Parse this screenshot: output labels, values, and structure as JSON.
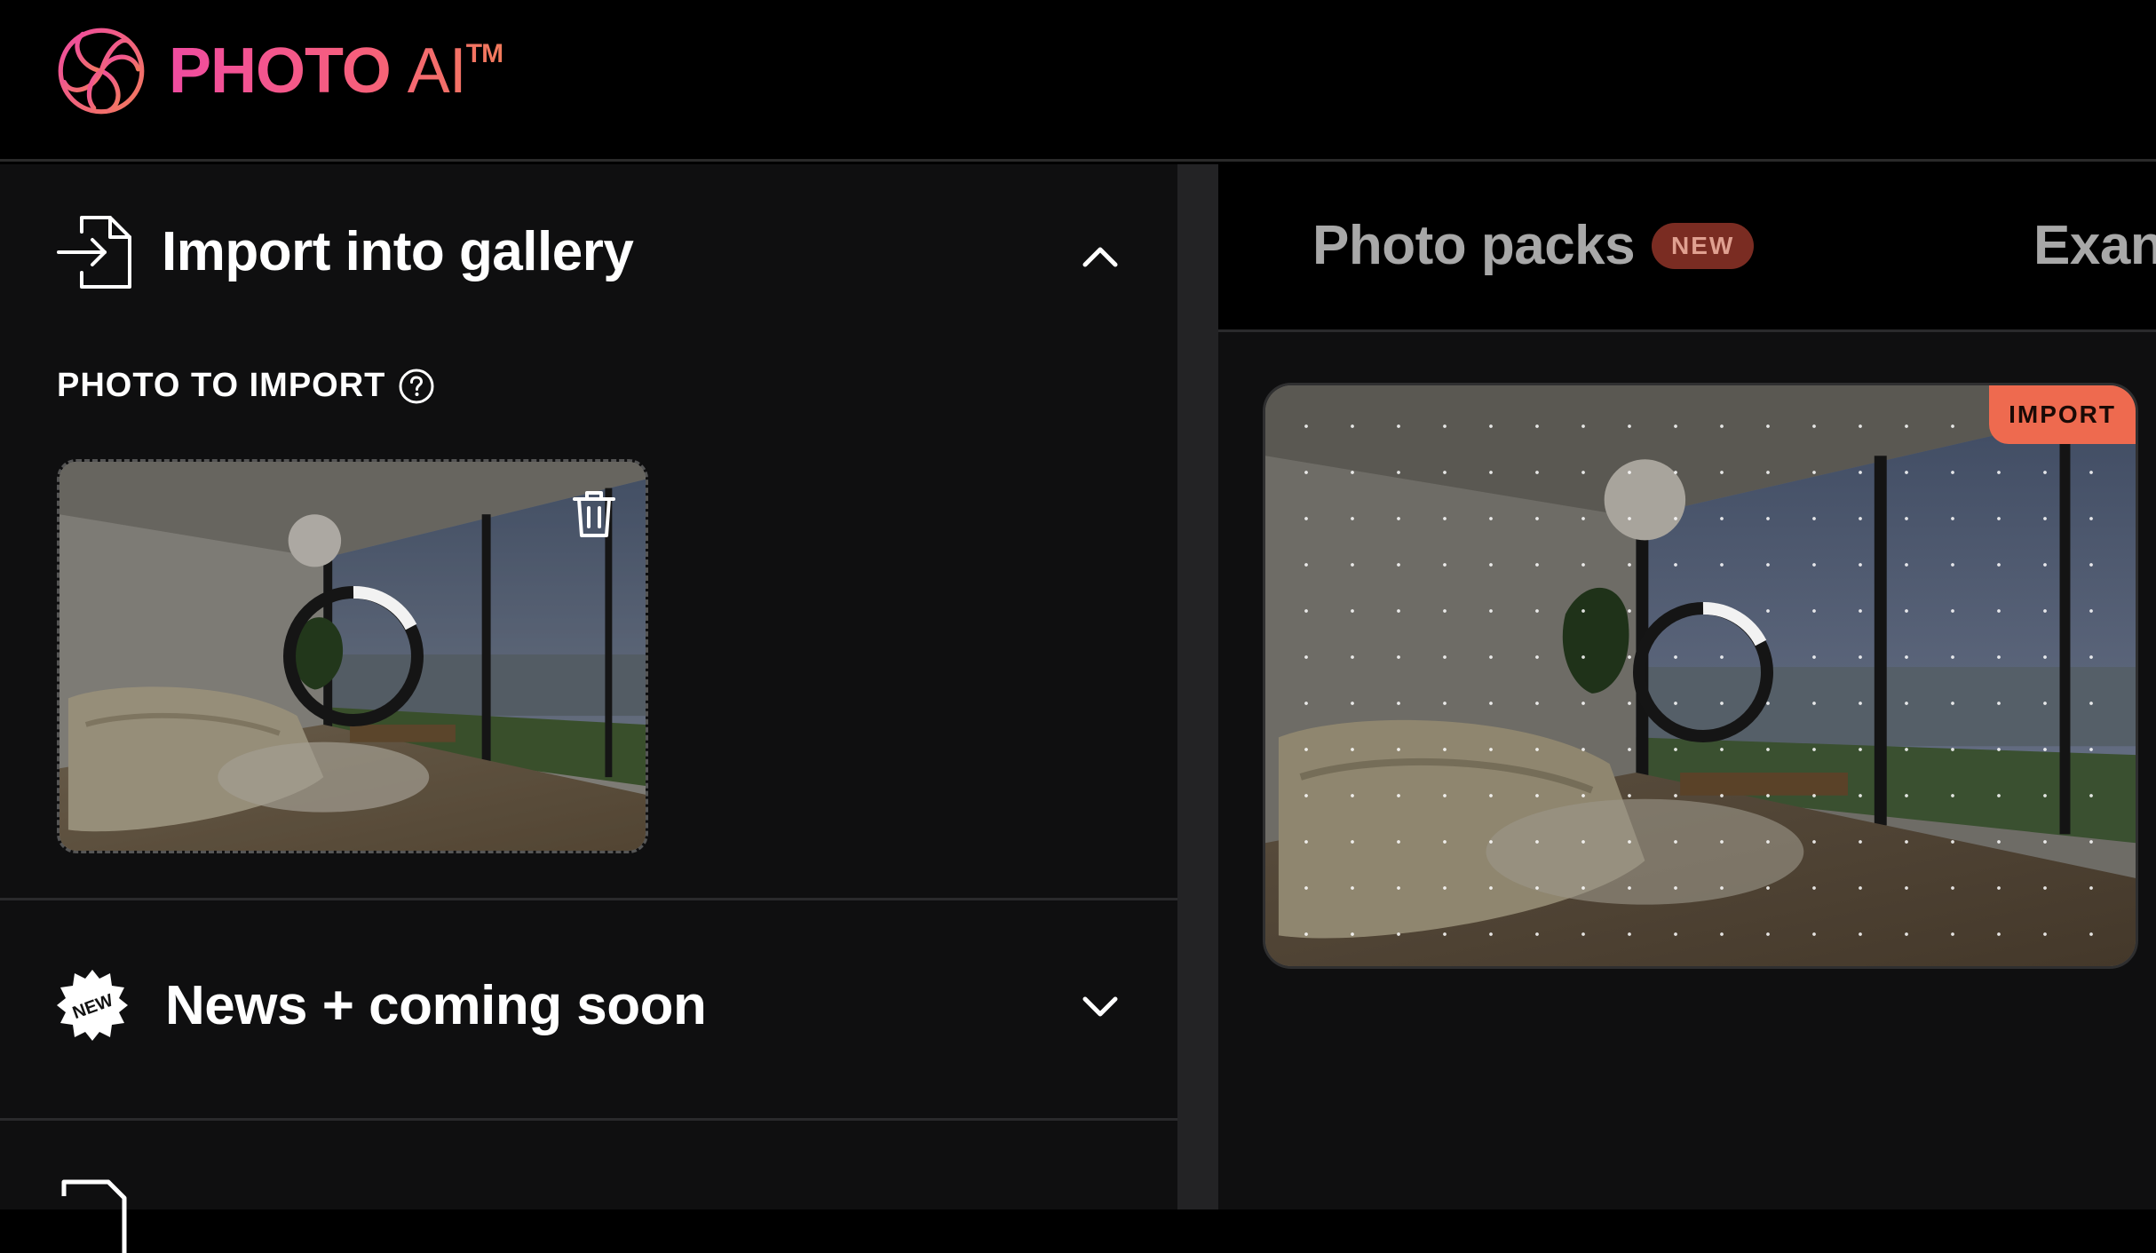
{
  "brand": {
    "name_bold": "PHOTO",
    "name_light": "AI",
    "trademark": "TM",
    "gradient_start": "#f04ba0",
    "gradient_end": "#f27a5c"
  },
  "import_section": {
    "title": "Import into gallery",
    "icon": "import-file-icon",
    "expanded": true,
    "photo_label": "PHOTO TO IMPORT",
    "help_icon": "question-circle-icon",
    "delete_icon": "trash-icon",
    "loading": true
  },
  "news_section": {
    "title": "News + coming soon",
    "icon": "new-badge-icon",
    "badge_text": "NEW",
    "expanded": false
  },
  "right_panel": {
    "tabs": [
      {
        "label": "Photo packs",
        "badge": "NEW"
      },
      {
        "label": "Exan"
      }
    ],
    "preview_badge": "IMPORT",
    "loading": true
  },
  "colors": {
    "accent": "#ee6a4f",
    "badge_bg": "#7a2c22",
    "panel_bg": "#0f0f10"
  }
}
